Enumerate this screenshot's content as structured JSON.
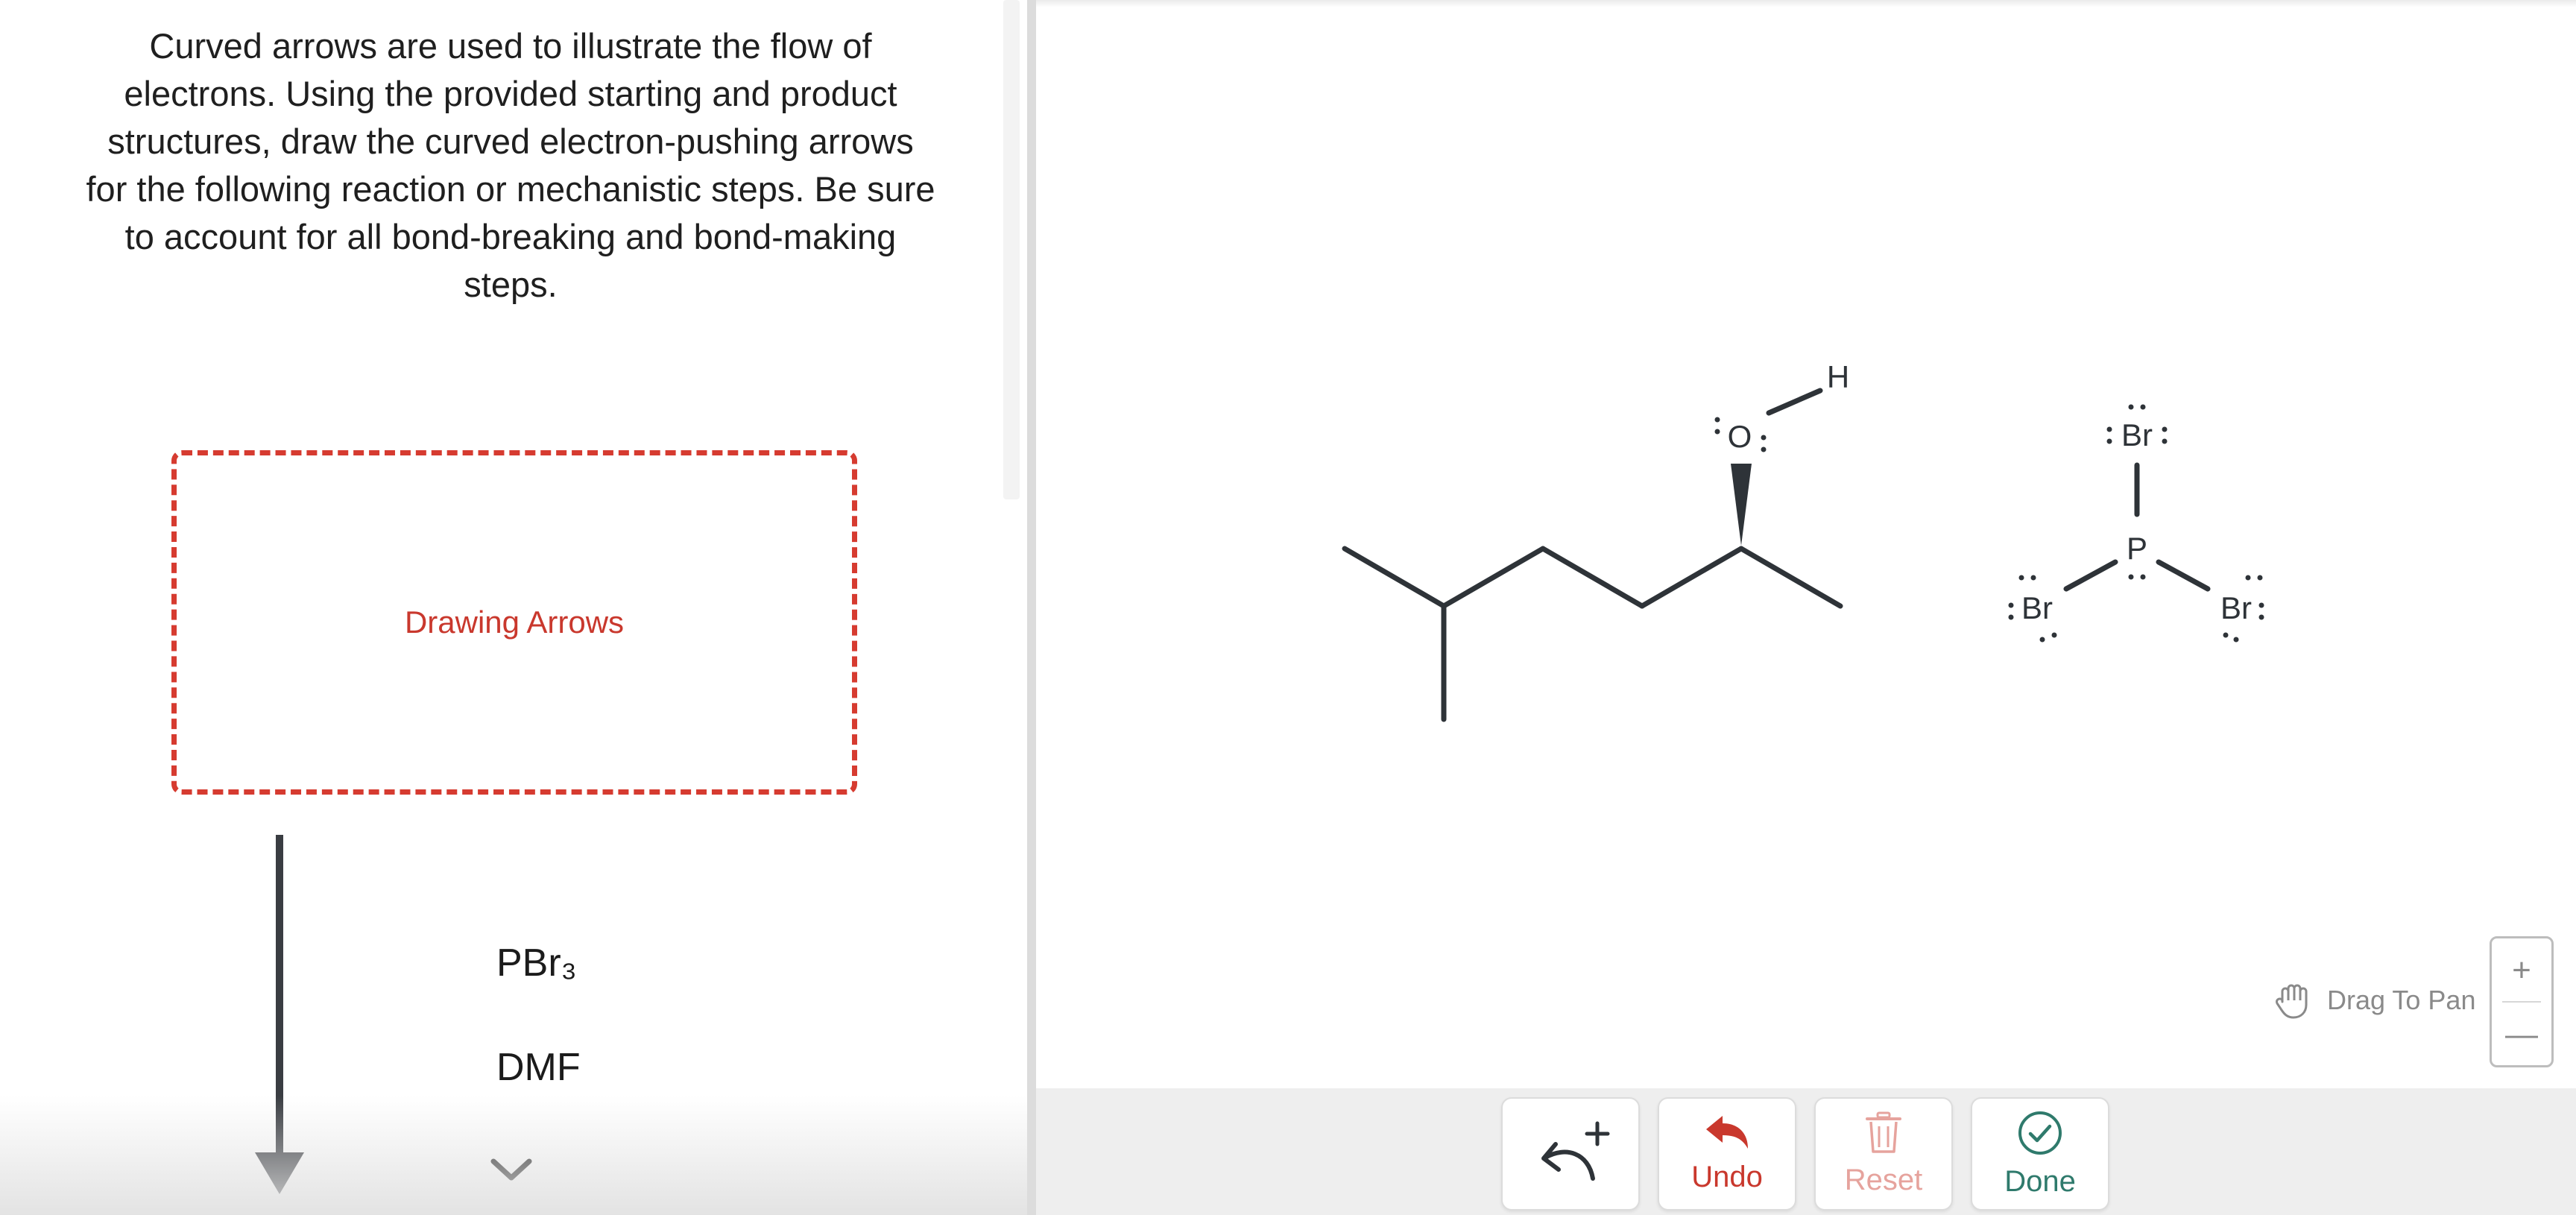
{
  "instructions": {
    "line1": "Curved arrows are used to illustrate the flow of",
    "line2": "electrons. Using the provided starting and product",
    "line3": "structures, draw the curved electron-pushing arrows",
    "line4": "for the following reaction or mechanistic steps. Be sure",
    "line5": "to account for all bond-breaking and bond-making",
    "line6": "steps."
  },
  "drawing_box": {
    "label": "Drawing Arrows"
  },
  "reagents": {
    "first": "PBr₃",
    "second": "DMF"
  },
  "molecules": {
    "alcohol": {
      "oxygen": "O",
      "hydrogen": "H"
    },
    "pbr3": {
      "phosphorus": "P",
      "br_top": "Br",
      "br_left": "Br",
      "br_right": "Br"
    }
  },
  "canvas": {
    "drag_hint": "Drag To Pan",
    "zoom_in": "+",
    "zoom_out": "—"
  },
  "toolbar": {
    "undo_label": "Undo",
    "reset_label": "Reset",
    "done_label": "Done"
  },
  "colors": {
    "accent_red": "#c9382d",
    "done_green": "#2f7a6c",
    "bond": "#2e3338"
  },
  "icons": {
    "arrow_tool": "curved-arrow-plus-icon",
    "undo": "undo-icon",
    "reset": "trash-icon",
    "done": "check-circle-icon",
    "pan": "hand-icon",
    "expand": "chevron-down-icon"
  }
}
